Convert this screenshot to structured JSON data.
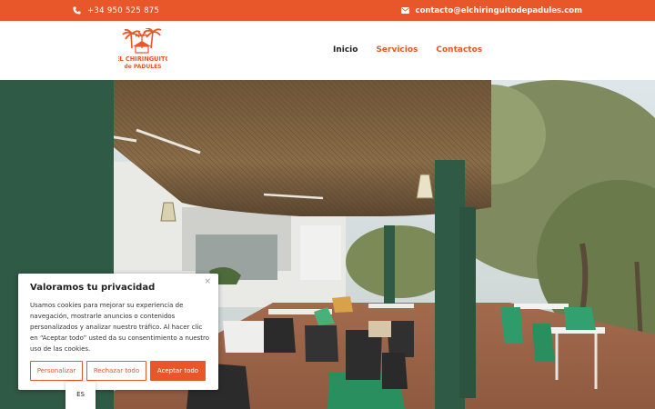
{
  "topbar": {
    "phone": "+34 950 525 875",
    "email": "contacto@elchiringuitodepadules.com",
    "phone_icon": "phone-icon",
    "email_icon": "envelope-icon",
    "color": "#e8572a"
  },
  "logo": {
    "line1": "EL CHIRINGUITO",
    "line2": "de PADULES"
  },
  "nav": {
    "items": [
      "Inicio",
      "Servicios",
      "Contactos"
    ]
  },
  "cookie": {
    "title": "Valoramos tu privacidad",
    "text": "Usamos cookies para mejorar su experiencia de navegación, mostrarle anuncios o contenidos personalizados y analizar nuestro tráfico. Al hacer clic en “Aceptar todo” usted da su consentimiento a nuestro uso de las cookies.",
    "customize": "Personalizar",
    "reject": "Rechazar todo",
    "accept": "Aceptar todo",
    "close_icon": "close-icon"
  },
  "language": {
    "current": "ES"
  },
  "colors": {
    "accent": "#e8572a",
    "text": "#222222"
  }
}
